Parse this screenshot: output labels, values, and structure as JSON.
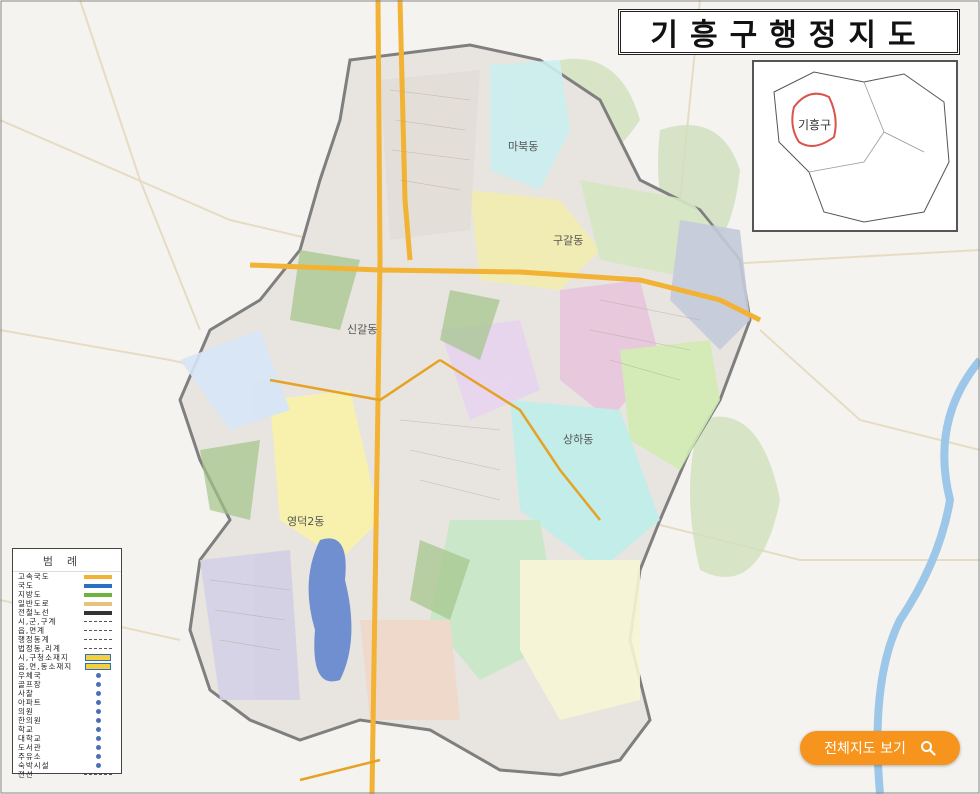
{
  "map": {
    "title": "기흥구행정지도",
    "inset_label": "기흥구",
    "dong_labels": [
      "구갈동",
      "신갈동",
      "상하동",
      "영덕2동",
      "마북동"
    ],
    "colors": {
      "highway": "#f2b233",
      "water": "#6f8fd0",
      "forest": "#a3c589",
      "district_border": "#d9534f"
    }
  },
  "legend": {
    "title": "범례",
    "items": [
      {
        "label": "고속국도",
        "symbol": "highway"
      },
      {
        "label": "국도",
        "symbol": "national"
      },
      {
        "label": "지방도",
        "symbol": "local"
      },
      {
        "label": "일반도로",
        "symbol": "road"
      },
      {
        "label": "전철노선",
        "symbol": "rail"
      },
      {
        "label": "시,군,구계",
        "symbol": "boundary"
      },
      {
        "label": "읍,면계",
        "symbol": "boundary2"
      },
      {
        "label": "행정동계",
        "symbol": "boundary3"
      },
      {
        "label": "법정동,리계",
        "symbol": "boundary4"
      },
      {
        "label": "시,구청소재지",
        "symbol": "office"
      },
      {
        "label": "읍,면,동소재지",
        "symbol": "office2"
      },
      {
        "label": "우체국",
        "symbol": "post-icon"
      },
      {
        "label": "골프장",
        "symbol": "golf-icon"
      },
      {
        "label": "사찰",
        "symbol": "temple-icon"
      },
      {
        "label": "아파트",
        "symbol": "apartment-icon"
      },
      {
        "label": "의원",
        "symbol": "clinic-icon"
      },
      {
        "label": "한의원",
        "symbol": "oriental-clinic-icon"
      },
      {
        "label": "학교",
        "symbol": "school-icon"
      },
      {
        "label": "대학교",
        "symbol": "university-icon"
      },
      {
        "label": "도서관",
        "symbol": "library-icon"
      },
      {
        "label": "주유소",
        "symbol": "gas-icon"
      },
      {
        "label": "숙박시설",
        "symbol": "lodging-icon"
      },
      {
        "label": "전선",
        "symbol": "line"
      }
    ]
  },
  "view_full_map_button": {
    "label": "전체지도 보기",
    "icon": "search-icon"
  }
}
